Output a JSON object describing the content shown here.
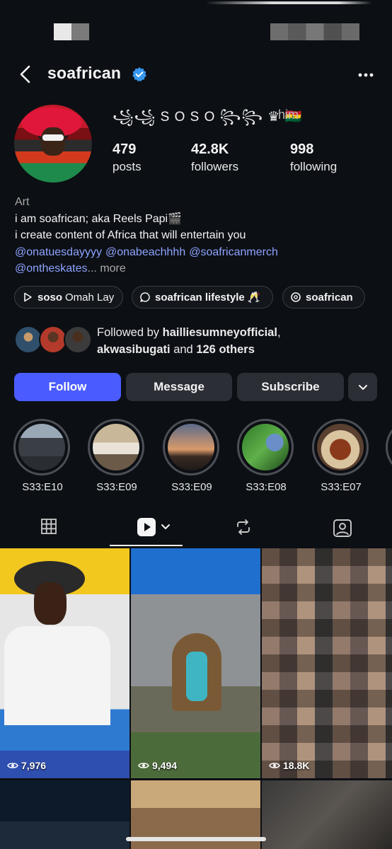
{
  "profile": {
    "username": "soafrican",
    "display_name": "꧁꧁ S O S O ꧂꧂ ♛ 🇬🇭",
    "pronouns": "him",
    "stats": [
      {
        "value": "479",
        "label": "posts"
      },
      {
        "value": "42.8K",
        "label": "followers"
      },
      {
        "value": "998",
        "label": "following"
      }
    ]
  },
  "bio": {
    "category": "Art",
    "line1": "i am soafrican; aka Reels Papi🎬",
    "line2": "i create content of Africa that will entertain you",
    "mentions": [
      "@onatuesdayyyy",
      "@onabeachhhh",
      "@soafricanmerch",
      "@ontheskates"
    ],
    "more": "... more"
  },
  "chips": [
    {
      "bold": "soso",
      "text": "Omah Lay",
      "icon": "play-icon"
    },
    {
      "bold": "soafrican lifestyle 🥂",
      "text": "",
      "icon": "chat-icon"
    },
    {
      "bold": "soafrican",
      "text": "",
      "icon": "threads-icon"
    }
  ],
  "followed_by": {
    "prefix": "Followed by ",
    "user1": "hailliesumneyofficial",
    "comma": ",",
    "user2": "akwasibugati",
    "middle": " and ",
    "others": "126 others"
  },
  "actions": {
    "follow": "Follow",
    "message": "Message",
    "subscribe": "Subscribe"
  },
  "highlights": [
    {
      "label": "S33:E10"
    },
    {
      "label": "S33:E09"
    },
    {
      "label": "S33:E09"
    },
    {
      "label": "S33:E08"
    },
    {
      "label": "S33:E07"
    }
  ],
  "grid": [
    {
      "views": "7,976"
    },
    {
      "views": "9,494"
    },
    {
      "views": "18.8K"
    }
  ],
  "colors": {
    "accent": "#4a5cff",
    "mention": "#8da3ff",
    "verified": "#3797f0",
    "background": "#0c0f14"
  }
}
